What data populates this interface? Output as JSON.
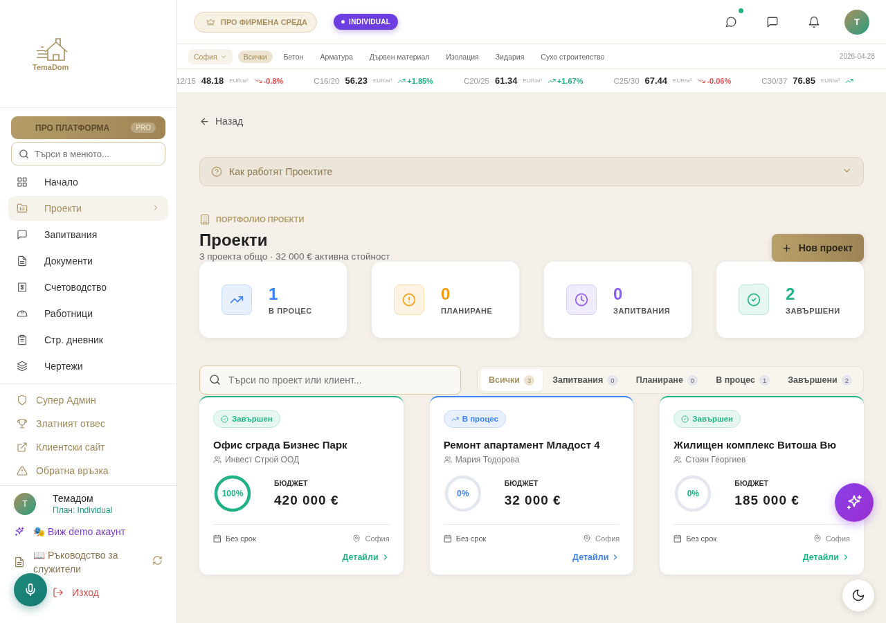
{
  "logo": {
    "text": "TemaDom"
  },
  "sidebar": {
    "pro_button": {
      "label": "ПРО ПЛАТФОРМА",
      "badge": "PRO"
    },
    "search": {
      "placeholder": "Търси в менюто..."
    },
    "nav": [
      {
        "label": "Начало",
        "selected": false
      },
      {
        "label": "Проекти",
        "selected": true
      },
      {
        "label": "Запитвания",
        "selected": false
      },
      {
        "label": "Документи",
        "selected": false
      },
      {
        "label": "Счетоводство",
        "selected": false
      },
      {
        "label": "Работници",
        "selected": false
      },
      {
        "label": "Стр. дневник",
        "selected": false
      },
      {
        "label": "Чертежи",
        "selected": false
      }
    ],
    "extras": [
      "Супер Админ",
      "Златният отвес",
      "Клиентски сайт",
      "Обратна връзка"
    ],
    "user": {
      "initial": "T",
      "name": "Темадом",
      "plan": "План: Individual"
    },
    "demo": "🎭 Виж demo акаунт",
    "guide": "📖 Ръководство за служители",
    "logout": "Изход"
  },
  "header": {
    "pro_env": "ПРО ФИРМЕНА СРЕДА",
    "plan_badge": "INDIVIDUAL",
    "avatar": "T",
    "chat_unread": true
  },
  "categories": {
    "city": "София",
    "items": [
      {
        "label": "Всички",
        "selected": true
      },
      {
        "label": "Бетон",
        "selected": false
      },
      {
        "label": "Арматура",
        "selected": false
      },
      {
        "label": "Дървен материал",
        "selected": false
      },
      {
        "label": "Изолация",
        "selected": false
      },
      {
        "label": "Зидария",
        "selected": false
      },
      {
        "label": "Сухо строителство",
        "selected": false
      }
    ],
    "date": "2026-04-28"
  },
  "ticker": [
    {
      "grade": "12/15",
      "price": "48.18",
      "unit": "EUR/м³",
      "rising": false,
      "change": "-0.8%"
    },
    {
      "grade": "C16/20",
      "price": "56.23",
      "unit": "EUR/м³",
      "rising": true,
      "change": "+1.85%"
    },
    {
      "grade": "C20/25",
      "price": "61.34",
      "unit": "EUR/м³",
      "rising": true,
      "change": "+1.67%"
    },
    {
      "grade": "C25/30",
      "price": "67.44",
      "unit": "EUR/м³",
      "rising": false,
      "change": "-0.06%"
    },
    {
      "grade": "C30/37",
      "price": "76.85",
      "unit": "EUR/м³",
      "rising": true
    }
  ],
  "back": "Назад",
  "help": {
    "label": "Как работят Проектите",
    "expanded": false
  },
  "portfolio": {
    "eyebrow": "ПОРТФОЛИО ПРОЕКТИ",
    "title": "Проекти",
    "subtitle": "3 проекта общо · 32 000 € активна стойност",
    "new_button": "Нов проект"
  },
  "stats": [
    {
      "kind": "in_progress",
      "value": "1",
      "label": "В ПРОЦЕС"
    },
    {
      "kind": "planning",
      "value": "0",
      "label": "ПЛАНИРАНЕ"
    },
    {
      "kind": "inquiries",
      "value": "0",
      "label": "ЗАПИТВАНИЯ"
    },
    {
      "kind": "done",
      "value": "2",
      "label": "ЗАВЪРШЕНИ"
    }
  ],
  "search": {
    "placeholder": "Търси по проект или клиент..."
  },
  "filters": [
    {
      "label": "Всички",
      "count": "3",
      "selected": true
    },
    {
      "label": "Запитвания",
      "count": "0",
      "selected": false
    },
    {
      "label": "Планиране",
      "count": "0",
      "selected": false
    },
    {
      "label": "В процес",
      "count": "1",
      "selected": false
    },
    {
      "label": "Завършени",
      "count": "2",
      "selected": false
    }
  ],
  "projects": [
    {
      "kind": "done",
      "status": "Завършен",
      "title": "Офис сграда Бизнес Парк",
      "client": "Инвест Строй ООД",
      "progress": "100%",
      "level": 1,
      "budget_label": "БЮДЖЕТ",
      "budget": "420 000 €",
      "deadline": "Без срок",
      "city": "София",
      "details": "Детайли"
    },
    {
      "kind": "in_progress",
      "status": "В процес",
      "title": "Ремонт апартамент Младост 4",
      "client": "Мария Тодорова",
      "progress": "0%",
      "level": 0,
      "budget_label": "БЮДЖЕТ",
      "budget": "32 000 €",
      "deadline": "Без срок",
      "city": "София",
      "details": "Детайли"
    },
    {
      "kind": "done",
      "status": "Завършен",
      "title": "Жилищен комплекс Витоша Вю",
      "client": "Стоян Георгиев",
      "progress": "0%",
      "level": 0,
      "budget_label": "БЮДЖЕТ",
      "budget": "185 000 €",
      "deadline": "Без срок",
      "city": "София",
      "details": "Детайли"
    }
  ]
}
